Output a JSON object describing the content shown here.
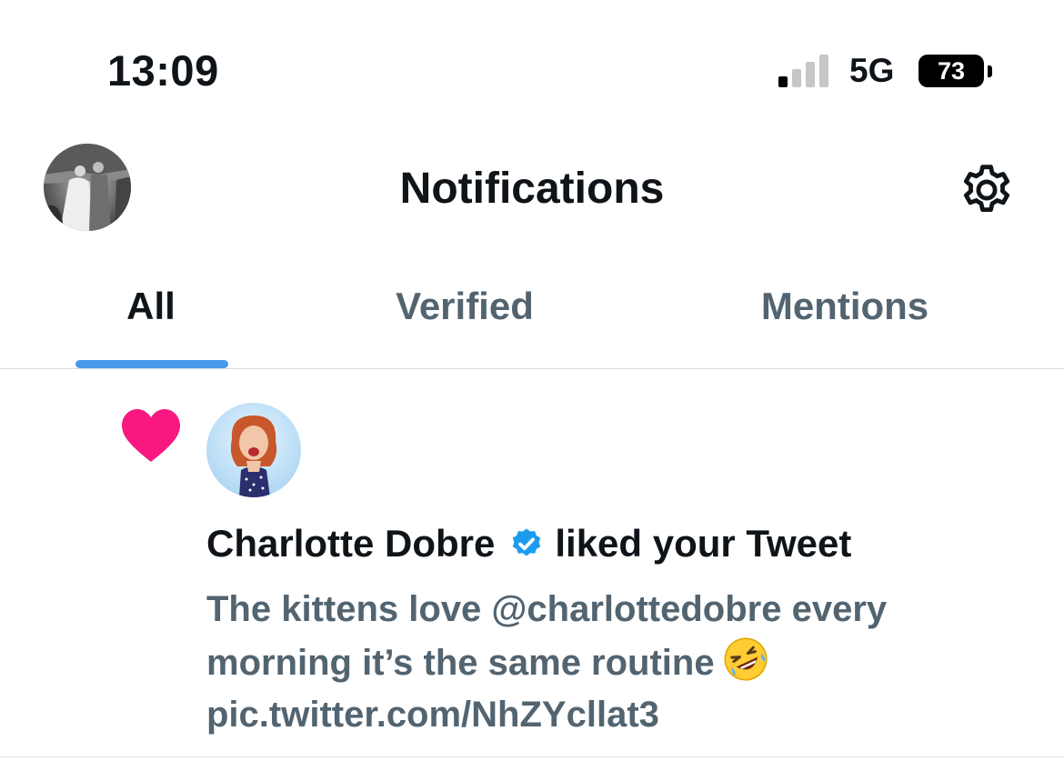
{
  "status_bar": {
    "time": "13:09",
    "network": "5G",
    "battery": "73",
    "signal_bars_active": 1,
    "signal_bars_total": 4
  },
  "header": {
    "title": "Notifications",
    "avatar_icon": "profile-avatar",
    "settings_icon": "gear-icon"
  },
  "tabs": [
    {
      "label": "All",
      "active": true
    },
    {
      "label": "Verified",
      "active": false
    },
    {
      "label": "Mentions",
      "active": false
    }
  ],
  "notification": {
    "type_icon": "heart-icon",
    "user_name": "Charlotte Dobre",
    "verified_icon": "verified-badge-icon",
    "action": "liked your Tweet",
    "tweet_text": "The kittens love @charlottedobre  every morning it’s the same routine",
    "tweet_emoji_icon": "rofl-emoji-icon",
    "tweet_link": "pic.twitter.com/NhZYcllat3"
  },
  "colors": {
    "accent": "#1d9bf0",
    "tab_indicator": "#4a99e9",
    "like": "#f91880",
    "secondary_text": "#536471",
    "primary_text": "#0f1419"
  }
}
